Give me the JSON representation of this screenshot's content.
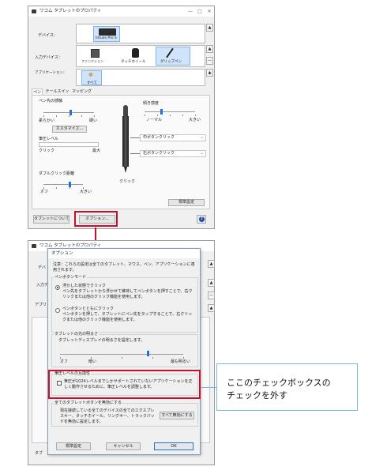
{
  "window1": {
    "title": "ワコム タブレットのプロパティ",
    "device_label": "デバイス：",
    "device_name": "Intuos Pro S",
    "input_device_label": "入力デバイス：",
    "input_devices": [
      "ファンクション",
      "タッチホイール",
      "グリップペン"
    ],
    "app_label": "アプリケーション：",
    "app_all": "すべて",
    "tabs": [
      "ペン",
      "テールスイッチ",
      "マッピング"
    ],
    "tip_feel_label": "ペン先の感触",
    "tip_soft": "柔らかい",
    "tip_firm": "硬い",
    "customize_button": "カスタマイズ...",
    "pressure_label": "筆圧レベル",
    "pressure_click": "クリック",
    "pressure_max": "最大",
    "doubleclick_label": "ダブルクリック距離",
    "dc_off": "オフ",
    "dc_large": "大きい",
    "tilt_label": "傾き感度",
    "tilt_normal": "ノーマル",
    "tilt_high": "大きい",
    "upper_button": "中ボタンクリック",
    "lower_button": "右ボタンクリック",
    "pen_click": "クリック",
    "default_button": "標準設定",
    "about_button": "タブレットについて",
    "options_button": "オプション...",
    "help_icon": "?"
  },
  "window2": {
    "title": "ワコム タブレットのプロパティ",
    "behind_labels": [
      "デバ",
      "入力デ",
      "アプリ"
    ],
    "dialog_title": "オプション",
    "note": "注意：これらの設定は全てのタブレット、マウス、ペン、アプリケーションに適用されます。",
    "pen_mode_group": "ペンボタンモード",
    "hover_click_title": "浮かした状態でクリック",
    "hover_click_desc": "ペン先をタブレットから浮かせて維持してペンボタンを押すことで、右クリックまたは他のクリック機能を使用します。",
    "tap_click_title": "ペンボタンとともにクリック",
    "tap_click_desc": "ペンボタンを押して、タブレットにペン先をタップすることで、右クリックまたは他のクリック機能を使用します。",
    "brightness_group": "タブレットの光の明るさ",
    "brightness_desc": "タブレットディスプレイの明るさを設定します。",
    "brightness_off": "オフ",
    "brightness_dim": "暗い",
    "brightness_bright": "最も明るい",
    "pressure_compat_group": "筆圧レベルの互換性",
    "pressure_compat_desc": "筆圧が1024レベルまでしかサポートされていないアプリケーションを正しく動作させるために、筆圧レベルを調整します。",
    "disable_buttons_group": "全てのタブレットボタンを無効にする",
    "disable_buttons_desc": "現在接続している全てのデバイスの全てのエクスプレスキー、タッチホイール、リングキー、トラックパッドを無効に設定します。",
    "disable_all_button": "すべて無効にする",
    "default_button": "標準設定",
    "cancel_button": "キャンセル",
    "ok_button": "OK",
    "bottom_left_behind": "タブ"
  },
  "callout": {
    "text_line1": "ここのチェックボックスの",
    "text_line2": "チェックを外す"
  },
  "colors": {
    "highlight_red": "#c8102e",
    "callout_border": "#7ab6e0",
    "accent_blue": "#1e73d9"
  }
}
